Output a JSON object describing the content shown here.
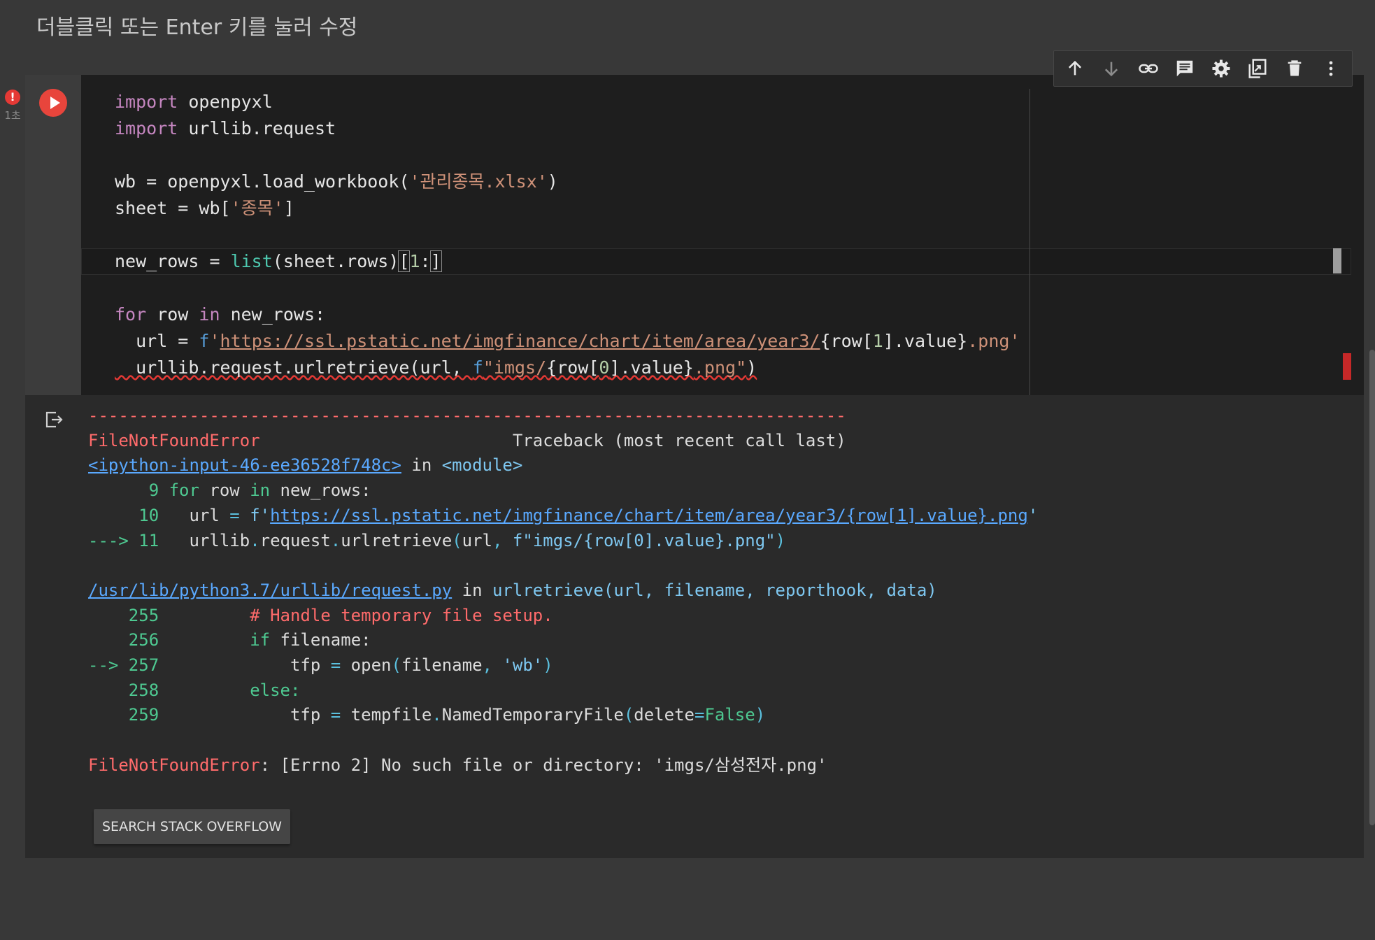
{
  "markdown_hint": "더블클릭 또는 Enter 키를 눌러 수정",
  "status": {
    "error_badge": "!",
    "exec_time": "1초"
  },
  "toolbar": {
    "icons": [
      "arrow-up-icon",
      "arrow-down-icon",
      "link-icon",
      "comment-icon",
      "gear-icon",
      "mirror-cell-icon",
      "trash-icon",
      "more-vert-icon"
    ]
  },
  "code": {
    "l1_kw": "import",
    "l1_rest": " openpyxl",
    "l2_kw": "import",
    "l2_rest": " urllib.request",
    "l4_a": "wb = openpyxl.load_workbook(",
    "l4_str": "'관리종목.xlsx'",
    "l4_b": ")",
    "l5_a": "sheet = wb[",
    "l5_str": "'종목'",
    "l5_b": "]",
    "l7_a": "new_rows = ",
    "l7_fn": "list",
    "l7_b": "(sheet.rows)",
    "l7_br1": "[",
    "l7_num": "1",
    "l7_c": ":",
    "l7_br2": "]",
    "l9_for": "for",
    "l9_a": " row ",
    "l9_in": "in",
    "l9_b": " new_rows:",
    "l10_a": "  url = ",
    "l10_f": "f",
    "l10_q": "'",
    "l10_url": "https://ssl.pstatic.net/imgfinance/chart/item/area/year3/",
    "l10_b": "{row[",
    "l10_num": "1",
    "l10_c": "].value}",
    "l10_ext": ".png'",
    "l11_a": "  urllib.request.urlretrieve(url, ",
    "l11_f": "f",
    "l11_s1": "\"imgs/",
    "l11_b": "{row[",
    "l11_num": "0",
    "l11_c": "].value}",
    "l11_s2": ".png\"",
    "l11_d": ")"
  },
  "output": {
    "dashes": "---------------------------------------------------------------------------",
    "error_name": "FileNotFoundError",
    "traceback_label": "Traceback (most recent call last)",
    "input_link": "<ipython-input-46-ee36528f748c>",
    "in_module_a": " in ",
    "in_module_b": "<module>",
    "t1_no": "      9 ",
    "t1_for": "for",
    "t1_a": " row ",
    "t1_in": "in",
    "t1_b": " new_rows:",
    "t2_no": "     10 ",
    "t2_a": "  url ",
    "t2_eq": "=",
    "t2_b": " f'",
    "t2_url": "https://ssl.pstatic.net/imgfinance/chart/item/area/year3/{row[1].value}.png",
    "t2_c": "'",
    "t3_arrow": "---> 11 ",
    "t3_a": "  urllib",
    "t3_d1": ".",
    "t3_b": "request",
    "t3_d2": ".",
    "t3_c": "urlretrieve",
    "t3_p": "(",
    "t3_e": "url",
    "t3_cm": ",",
    "t3_f": " f\"imgs/{row[0].value}.png\"",
    "t3_p2": ")",
    "file_link": "/usr/lib/python3.7/urllib/request.py",
    "in_func_a": " in ",
    "in_func_b": "urlretrieve(url, filename, reporthook, data)",
    "s1_no": "    255 ",
    "s1_comment": "        # Handle temporary file setup.",
    "s2_no": "    256 ",
    "s2_if": "        if",
    "s2_a": " filename:",
    "s3_arrow": "--> 257 ",
    "s3_a": "            tfp ",
    "s3_eq": "=",
    "s3_b": " open",
    "s3_p": "(",
    "s3_c": "filename",
    "s3_cm": ",",
    "s3_str": " 'wb'",
    "s3_p2": ")",
    "s4_no": "    258 ",
    "s4_else": "        else:",
    "s5_no": "    259 ",
    "s5_a": "            tfp ",
    "s5_eq": "=",
    "s5_b": " tempfile",
    "s5_d": ".",
    "s5_c": "NamedTemporaryFile",
    "s5_p": "(",
    "s5_e": "delete",
    "s5_eq2": "=",
    "s5_false": "False",
    "s5_p2": ")",
    "final_err": "FileNotFoundError",
    "final_msg": ": [Errno 2] No such file or directory: 'imgs/삼성전자.png'"
  },
  "search_button": "SEARCH STACK OVERFLOW",
  "colors": {
    "run_button": "#e8453c",
    "error_red": "#ff6b6b",
    "link_blue": "#5aa9ff",
    "keyword_green": "#4ec991"
  }
}
